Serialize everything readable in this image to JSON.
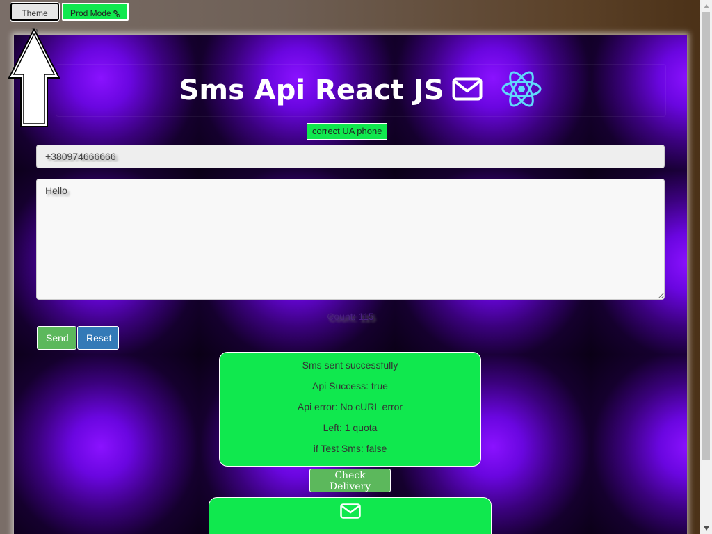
{
  "toolbar": {
    "theme_label": "Theme",
    "theme_icon": "refresh-icon",
    "prod_mode_label": "Prod Mode",
    "prod_mode_icon": "link-icon"
  },
  "header": {
    "title": "Sms Api React JS",
    "envelope_icon": "envelope-icon",
    "react_logo": "react-atom-logo"
  },
  "form": {
    "phone_status": "correct UA phone",
    "phone_value": "+380974666666",
    "message_value": "Hello",
    "count_text": "Count: 115",
    "send_label": "Send",
    "reset_label": "Reset"
  },
  "result": {
    "lines": [
      "Sms sent successfully",
      "Api Success: true",
      "Api error: No cURL error",
      "Left: 1 quota",
      "if Test Sms: false"
    ]
  },
  "delivery": {
    "check_label": "Check Delivery",
    "envelope_icon": "envelope-icon",
    "label": ""
  },
  "colors": {
    "accent_green": "#10e84e",
    "send_green": "#5cb85c",
    "reset_blue": "#337ab7",
    "panel_purple": "#8a12ff"
  }
}
